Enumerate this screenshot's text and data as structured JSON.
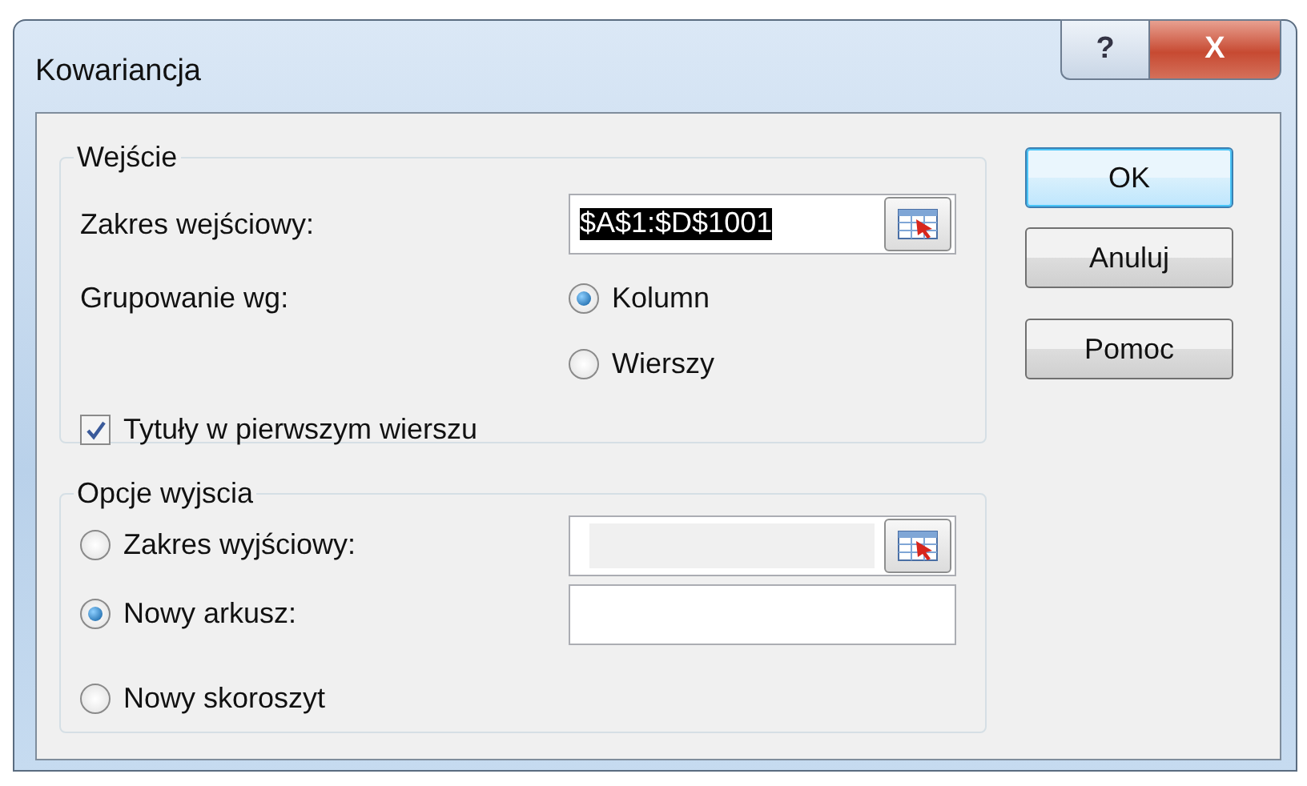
{
  "window": {
    "title": "Kowariancja",
    "buttons": [
      {
        "kind": "help",
        "label": "?"
      },
      {
        "kind": "close",
        "label": "X"
      }
    ]
  },
  "input_group": {
    "title": "Wejście",
    "range": {
      "label": "Zakres wejściowy:",
      "value": "$A$1:$D$1001",
      "text_selected": true
    },
    "grouping": {
      "label": "Grupowanie wg:",
      "options": [
        {
          "label": "Kolumn",
          "selected": true
        },
        {
          "label": "Wierszy",
          "selected": false
        }
      ]
    },
    "titles_checkbox": {
      "label": "Tytuły w pierwszym wierszu",
      "checked": true
    }
  },
  "output_group": {
    "title": "Opcje wyjscia",
    "options": [
      {
        "kind": "range",
        "label": "Zakres wyjściowy:",
        "selected": false,
        "field_disabled": true
      },
      {
        "kind": "field",
        "label": "Nowy arkusz:",
        "selected": true,
        "field_disabled": false
      },
      {
        "kind": "plain",
        "label": "Nowy skoroszyt",
        "selected": false
      }
    ]
  },
  "buttons": [
    {
      "label": "OK",
      "default": true
    },
    {
      "label": "Anuluj",
      "default": false
    },
    {
      "label": "Pomoc",
      "default": false
    }
  ]
}
